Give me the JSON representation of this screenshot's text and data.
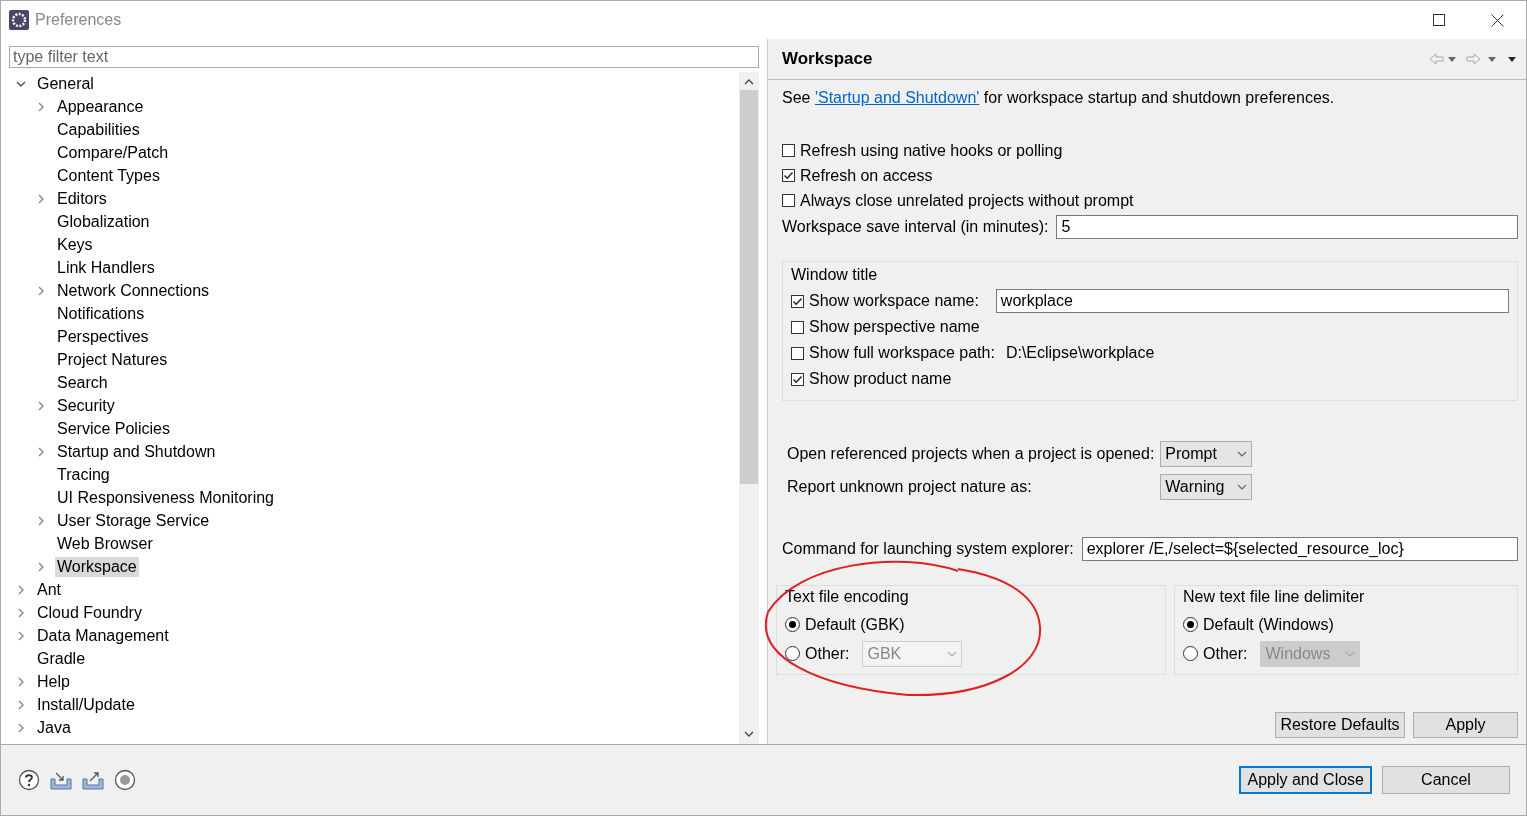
{
  "window": {
    "title": "Preferences"
  },
  "filter": {
    "placeholder": "type filter text"
  },
  "tree": [
    {
      "label": "General",
      "kind": "branch",
      "expanded": true,
      "selected": false,
      "children": [
        {
          "label": "Appearance",
          "kind": "branch",
          "expanded": false,
          "selected": false
        },
        {
          "label": "Capabilities",
          "kind": "leaf",
          "selected": false
        },
        {
          "label": "Compare/Patch",
          "kind": "leaf",
          "selected": false
        },
        {
          "label": "Content Types",
          "kind": "leaf",
          "selected": false
        },
        {
          "label": "Editors",
          "kind": "branch",
          "expanded": false,
          "selected": false
        },
        {
          "label": "Globalization",
          "kind": "leaf",
          "selected": false
        },
        {
          "label": "Keys",
          "kind": "leaf",
          "selected": false
        },
        {
          "label": "Link Handlers",
          "kind": "leaf",
          "selected": false
        },
        {
          "label": "Network Connections",
          "kind": "branch",
          "expanded": false,
          "selected": false
        },
        {
          "label": "Notifications",
          "kind": "leaf",
          "selected": false
        },
        {
          "label": "Perspectives",
          "kind": "leaf",
          "selected": false
        },
        {
          "label": "Project Natures",
          "kind": "leaf",
          "selected": false
        },
        {
          "label": "Search",
          "kind": "leaf",
          "selected": false
        },
        {
          "label": "Security",
          "kind": "branch",
          "expanded": false,
          "selected": false
        },
        {
          "label": "Service Policies",
          "kind": "leaf",
          "selected": false
        },
        {
          "label": "Startup and Shutdown",
          "kind": "branch",
          "expanded": false,
          "selected": false
        },
        {
          "label": "Tracing",
          "kind": "leaf",
          "selected": false
        },
        {
          "label": "UI Responsiveness Monitoring",
          "kind": "leaf",
          "selected": false
        },
        {
          "label": "User Storage Service",
          "kind": "branch",
          "expanded": false,
          "selected": false
        },
        {
          "label": "Web Browser",
          "kind": "leaf",
          "selected": false
        },
        {
          "label": "Workspace",
          "kind": "branch",
          "expanded": false,
          "selected": true
        }
      ]
    },
    {
      "label": "Ant",
      "kind": "branch",
      "expanded": false,
      "selected": false
    },
    {
      "label": "Cloud Foundry",
      "kind": "branch",
      "expanded": false,
      "selected": false
    },
    {
      "label": "Data Management",
      "kind": "branch",
      "expanded": false,
      "selected": false
    },
    {
      "label": "Gradle",
      "kind": "leaf",
      "selected": false
    },
    {
      "label": "Help",
      "kind": "branch",
      "expanded": false,
      "selected": false
    },
    {
      "label": "Install/Update",
      "kind": "branch",
      "expanded": false,
      "selected": false
    },
    {
      "label": "Java",
      "kind": "branch",
      "expanded": false,
      "selected": false
    }
  ],
  "page": {
    "title": "Workspace",
    "intro": {
      "before": "See",
      "link": "'Startup and Shutdown'",
      "after": "for workspace startup and shutdown preferences."
    },
    "checkboxes": [
      {
        "label": "Refresh using native hooks or polling",
        "checked": false
      },
      {
        "label": "Refresh on access",
        "checked": true
      },
      {
        "label": "Always close unrelated projects without prompt",
        "checked": false
      }
    ],
    "save_interval": {
      "label": "Workspace save interval (in minutes):",
      "value": "5"
    },
    "window_title": {
      "title": "Window title",
      "rows": [
        {
          "kind": "field",
          "label": "Show workspace name:",
          "checked": true,
          "value": "workplace"
        },
        {
          "kind": "plain",
          "label": "Show perspective name",
          "checked": false
        },
        {
          "kind": "path",
          "label": "Show full workspace path:",
          "checked": false,
          "value": "D:\\Eclipse\\workplace"
        },
        {
          "kind": "plain",
          "label": "Show product name",
          "checked": true
        }
      ]
    },
    "combos": [
      {
        "label": "Open referenced projects when a project is opened:",
        "value": "Prompt"
      },
      {
        "label": "Report unknown project nature as:",
        "value": "Warning"
      }
    ],
    "command": {
      "label": "Command for launching system explorer:",
      "value": "explorer /E,/select=${selected_resource_loc}"
    },
    "groups": [
      {
        "title": "Text file encoding",
        "options": [
          {
            "label": "Default (GBK)",
            "selected": true
          },
          {
            "label": "Other:",
            "selected": false,
            "value": "GBK"
          }
        ]
      },
      {
        "title": "New text file line delimiter",
        "options": [
          {
            "label": "Default (Windows)",
            "selected": true
          },
          {
            "label": "Other:",
            "selected": false,
            "value": "Windows"
          }
        ]
      }
    ],
    "buttons": [
      "Restore Defaults",
      "Apply"
    ]
  },
  "footer": {
    "buttons": [
      {
        "label": "Apply and Close",
        "default": true
      },
      {
        "label": "Cancel",
        "default": false
      }
    ]
  }
}
